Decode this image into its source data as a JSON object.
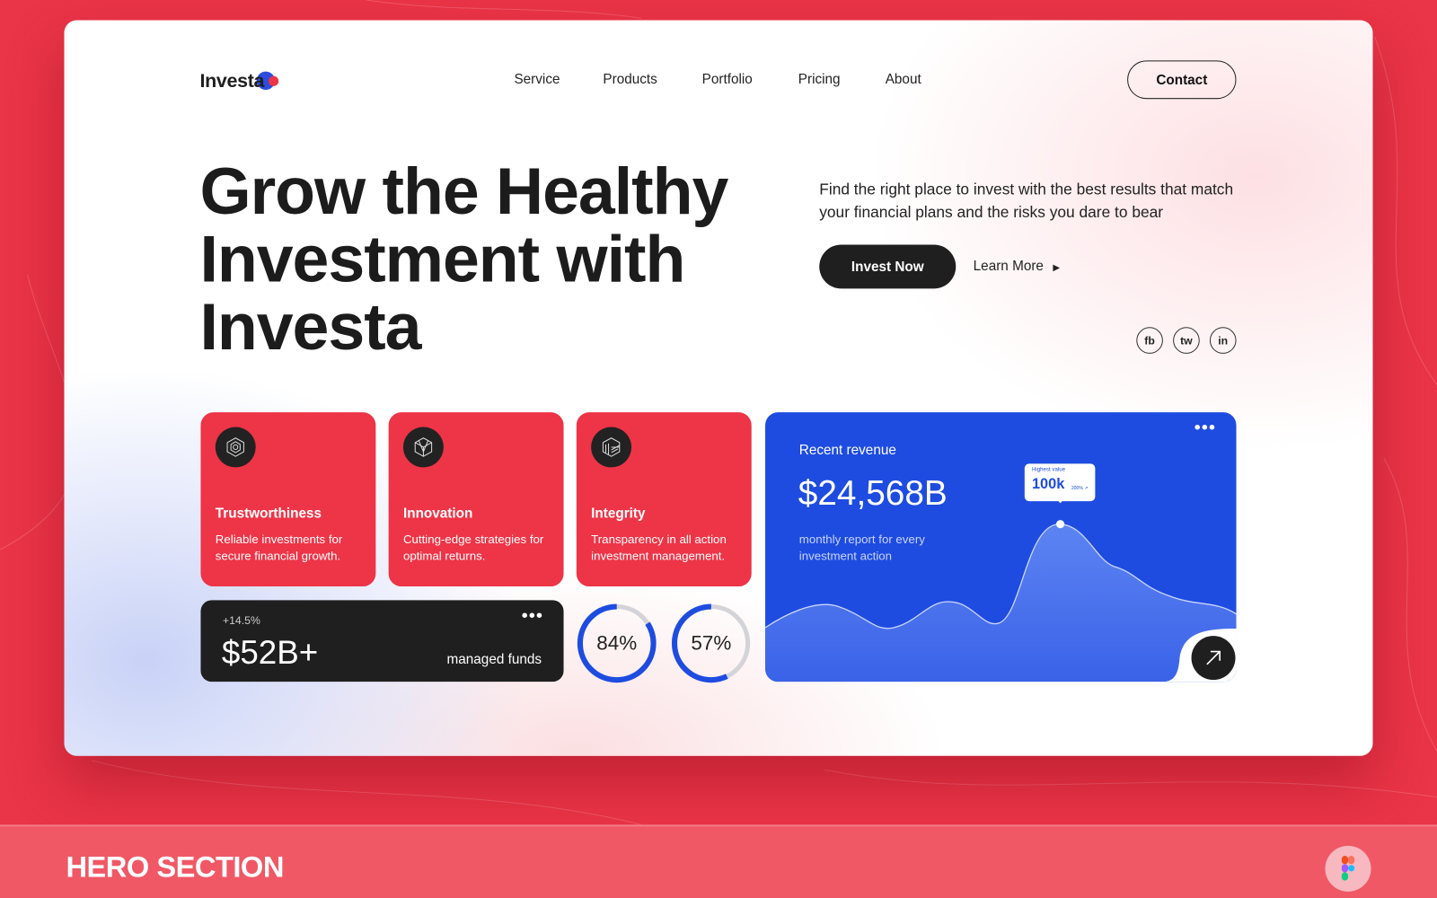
{
  "logo": {
    "text": "Investa",
    "accent": "#2b4de0",
    "dot": "#ee3447"
  },
  "nav": {
    "items": [
      "Service",
      "Products",
      "Portfolio",
      "Pricing",
      "About"
    ],
    "contact": "Contact"
  },
  "hero": {
    "title": "Grow the Healthy Investment with Investa",
    "subtitle": "Find the right place to invest with the best results that match your financial plans and the risks you dare to bear",
    "invest_now": "Invest Now",
    "learn_more": "Learn More"
  },
  "social": [
    "fb",
    "tw",
    "in"
  ],
  "features": [
    {
      "icon": "hexagon-icon",
      "title": "Trustworthiness",
      "desc": "Reliable investments for secure financial growth."
    },
    {
      "icon": "cube-icon",
      "title": "Innovation",
      "desc": "Cutting-edge strategies for optimal returns."
    },
    {
      "icon": "layers-cube-icon",
      "title": "Integrity",
      "desc": "Transparency in all action investment management."
    }
  ],
  "funds": {
    "change": "+14.5%",
    "value": "$52B+",
    "label": "managed funds"
  },
  "rings": [
    {
      "label": "84%",
      "value": 84
    },
    {
      "label": "57%",
      "value": 57
    }
  ],
  "revenue": {
    "title": "Recent revenue",
    "value": "$24,568B",
    "desc": "monthly report for every investment action",
    "tooltip_label": "Highest value",
    "tooltip_value": "100k",
    "tooltip_change": "200% ↗"
  },
  "footer": {
    "title": "HERO SECTION"
  },
  "colors": {
    "brand_red": "#ee3447",
    "brand_blue": "#1e4ce0",
    "dark": "#1f1f1f"
  }
}
